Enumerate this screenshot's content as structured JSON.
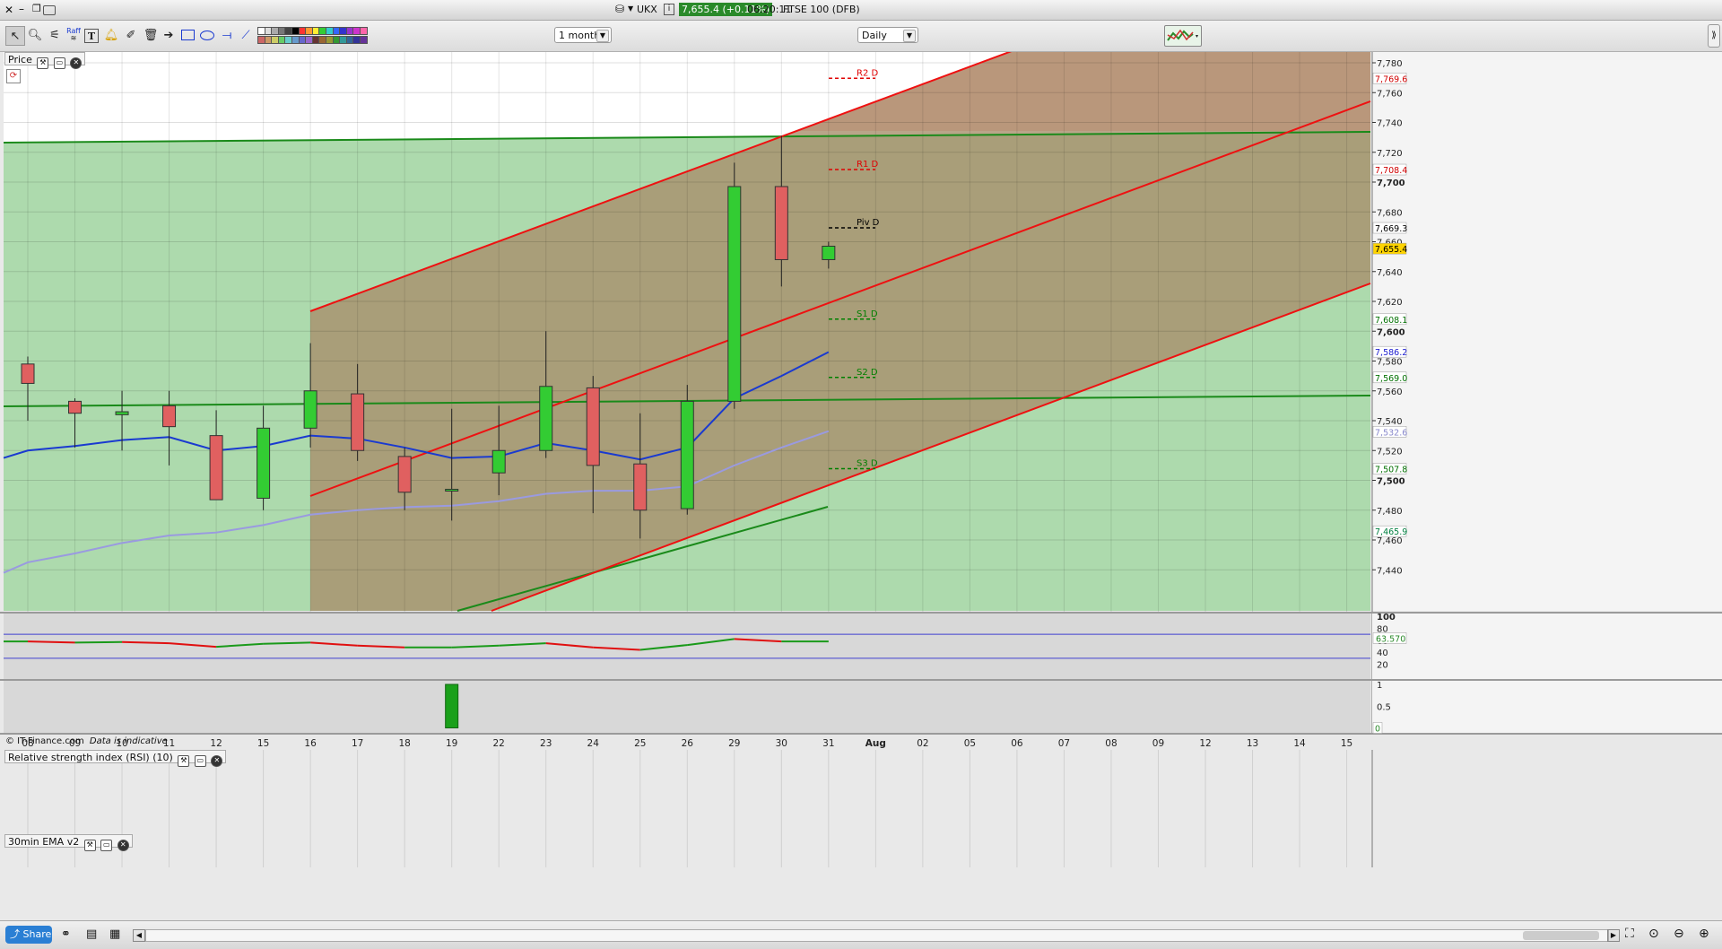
{
  "header": {
    "symbol": "UKX",
    "price_badge": "7,655.4 (+0.11%)",
    "clock": "06:20:11",
    "instrument": "FTSE 100 (DFB)",
    "info_icon": "i"
  },
  "toolbar": {
    "period": "1 month",
    "interval": "Daily",
    "raff_label": "Raff"
  },
  "panels": {
    "price_label": "Price",
    "rsi_label": "Relative strength index (RSI) (10)",
    "ema_label": "30min EMA v2",
    "copyright": "© IT-Finance.com",
    "indicative": "Data is indicative"
  },
  "pivots": [
    {
      "label": "R2 D",
      "value": 7769.6,
      "color": "#e00000"
    },
    {
      "label": "R1 D",
      "value": 7708.4,
      "color": "#e00000"
    },
    {
      "label": "Piv D",
      "value": 7669.3,
      "color": "#000000"
    },
    {
      "label": "S1 D",
      "value": 7608.1,
      "color": "#008000"
    },
    {
      "label": "S2 D",
      "value": 7569.0,
      "color": "#008000"
    },
    {
      "label": "S3 D",
      "value": 7507.8,
      "color": "#008000"
    }
  ],
  "axis_badges": [
    {
      "text": "7,769.6",
      "value": 7769.6,
      "fg": "#d00000",
      "bg": "#ffffff"
    },
    {
      "text": "7,708.4",
      "value": 7708.4,
      "fg": "#d00000",
      "bg": "#ffffff"
    },
    {
      "text": "7,669.3",
      "value": 7669.3,
      "fg": "#000000",
      "bg": "#ffffff"
    },
    {
      "text": "7,655.4",
      "value": 7655.4,
      "fg": "#000000",
      "bg": "#ffd400"
    },
    {
      "text": "7,608.1",
      "value": 7608.1,
      "fg": "#007000",
      "bg": "#ffffff"
    },
    {
      "text": "7,586.2",
      "value": 7586.2,
      "fg": "#2020d0",
      "bg": "#ffffff"
    },
    {
      "text": "7,569.0",
      "value": 7569.0,
      "fg": "#007000",
      "bg": "#ffffff"
    },
    {
      "text": "7,532.6",
      "value": 7532.6,
      "fg": "#8888cc",
      "bg": "#ffffff"
    },
    {
      "text": "7,507.8",
      "value": 7507.8,
      "fg": "#007000",
      "bg": "#ffffff"
    },
    {
      "text": "7,465.9",
      "value": 7465.9,
      "fg": "#008040",
      "bg": "#ffffff"
    }
  ],
  "rsi_badge": "63.570",
  "ema_badge": "0",
  "status": {
    "share_label": "Share"
  },
  "colors": {
    "up": "#33cc33",
    "down": "#e06060",
    "ema_fast": "#1a3ad0",
    "ema_slow": "#9a9ae0",
    "channel": "#ee1111",
    "trend": "#1a8a1a"
  },
  "chart_data": {
    "type": "candlestick",
    "y_ticks": [
      "7,780",
      "7,760",
      "7,740",
      "7,720",
      "7,700",
      "7,680",
      "7,660",
      "7,640",
      "7,620",
      "7,600",
      "7,580",
      "7,560",
      "7,540",
      "7,520",
      "7,500",
      "7,480",
      "7,460",
      "7,440"
    ],
    "y_tick_values": [
      7780,
      7760,
      7740,
      7720,
      7700,
      7680,
      7660,
      7640,
      7620,
      7600,
      7580,
      7560,
      7540,
      7520,
      7500,
      7480,
      7460,
      7440
    ],
    "ylim": [
      7422,
      7800
    ],
    "x_labels": [
      "08",
      "09",
      "10",
      "11",
      "12",
      "15",
      "16",
      "17",
      "18",
      "19",
      "22",
      "23",
      "24",
      "25",
      "26",
      "29",
      "30",
      "31",
      "Aug",
      "02",
      "05",
      "06",
      "07",
      "08",
      "09",
      "12",
      "13",
      "14",
      "15"
    ],
    "candles": [
      {
        "date": "08",
        "open": 7578,
        "high": 7583,
        "low": 7540,
        "close": 7565
      },
      {
        "date": "09",
        "open": 7553,
        "high": 7555,
        "low": 7522,
        "close": 7545
      },
      {
        "date": "10",
        "open": 7544,
        "high": 7560,
        "low": 7520,
        "close": 7546
      },
      {
        "date": "11",
        "open": 7550,
        "high": 7560,
        "low": 7510,
        "close": 7536
      },
      {
        "date": "12",
        "open": 7530,
        "high": 7547,
        "low": 7495,
        "close": 7487
      },
      {
        "date": "15",
        "open": 7488,
        "high": 7550,
        "low": 7480,
        "close": 7535
      },
      {
        "date": "16",
        "open": 7535,
        "high": 7592,
        "low": 7522,
        "close": 7560
      },
      {
        "date": "17",
        "open": 7558,
        "high": 7578,
        "low": 7513,
        "close": 7520
      },
      {
        "date": "18",
        "open": 7516,
        "high": 7522,
        "low": 7480,
        "close": 7492
      },
      {
        "date": "19",
        "open": 7493,
        "high": 7548,
        "low": 7473,
        "close": 7494
      },
      {
        "date": "22",
        "open": 7505,
        "high": 7550,
        "low": 7490,
        "close": 7520
      },
      {
        "date": "23",
        "open": 7520,
        "high": 7600,
        "low": 7515,
        "close": 7563
      },
      {
        "date": "24",
        "open": 7562,
        "high": 7570,
        "low": 7478,
        "close": 7510
      },
      {
        "date": "25",
        "open": 7511,
        "high": 7545,
        "low": 7461,
        "close": 7480
      },
      {
        "date": "26",
        "open": 7481,
        "high": 7564,
        "low": 7477,
        "close": 7553
      },
      {
        "date": "29",
        "open": 7553,
        "high": 7713,
        "low": 7548,
        "close": 7697
      },
      {
        "date": "30",
        "open": 7697,
        "high": 7731,
        "low": 7630,
        "close": 7648
      },
      {
        "date": "31",
        "open": 7648,
        "high": 7660,
        "low": 7642,
        "close": 7657
      }
    ],
    "ema_fast": [
      7515,
      7520,
      7523,
      7527,
      7529,
      7520,
      7523,
      7530,
      7528,
      7522,
      7515,
      7516,
      7525,
      7520,
      7514,
      7522,
      7555,
      7570,
      7586
    ],
    "ema_slow": [
      7438,
      7445,
      7451,
      7458,
      7463,
      7465,
      7470,
      7477,
      7480,
      7482,
      7483,
      7486,
      7491,
      7493,
      7493,
      7496,
      7510,
      7522,
      7533
    ],
    "rsi": {
      "values": [
        58,
        56,
        57,
        55,
        49,
        54,
        56,
        51,
        48,
        48,
        51,
        55,
        48,
        44,
        52,
        62,
        58,
        58
      ],
      "ylim": [
        0,
        100
      ],
      "y_ticks": [
        "100",
        "80",
        "60",
        "40",
        "20"
      ],
      "y_tick_values": [
        100,
        80,
        60,
        40,
        20
      ]
    },
    "ema_panel": {
      "y_ticks": [
        "1",
        "0.5",
        "0"
      ],
      "y_tick_values": [
        1,
        0.5,
        0
      ],
      "bar_date": "19",
      "bar_value": 1
    }
  }
}
